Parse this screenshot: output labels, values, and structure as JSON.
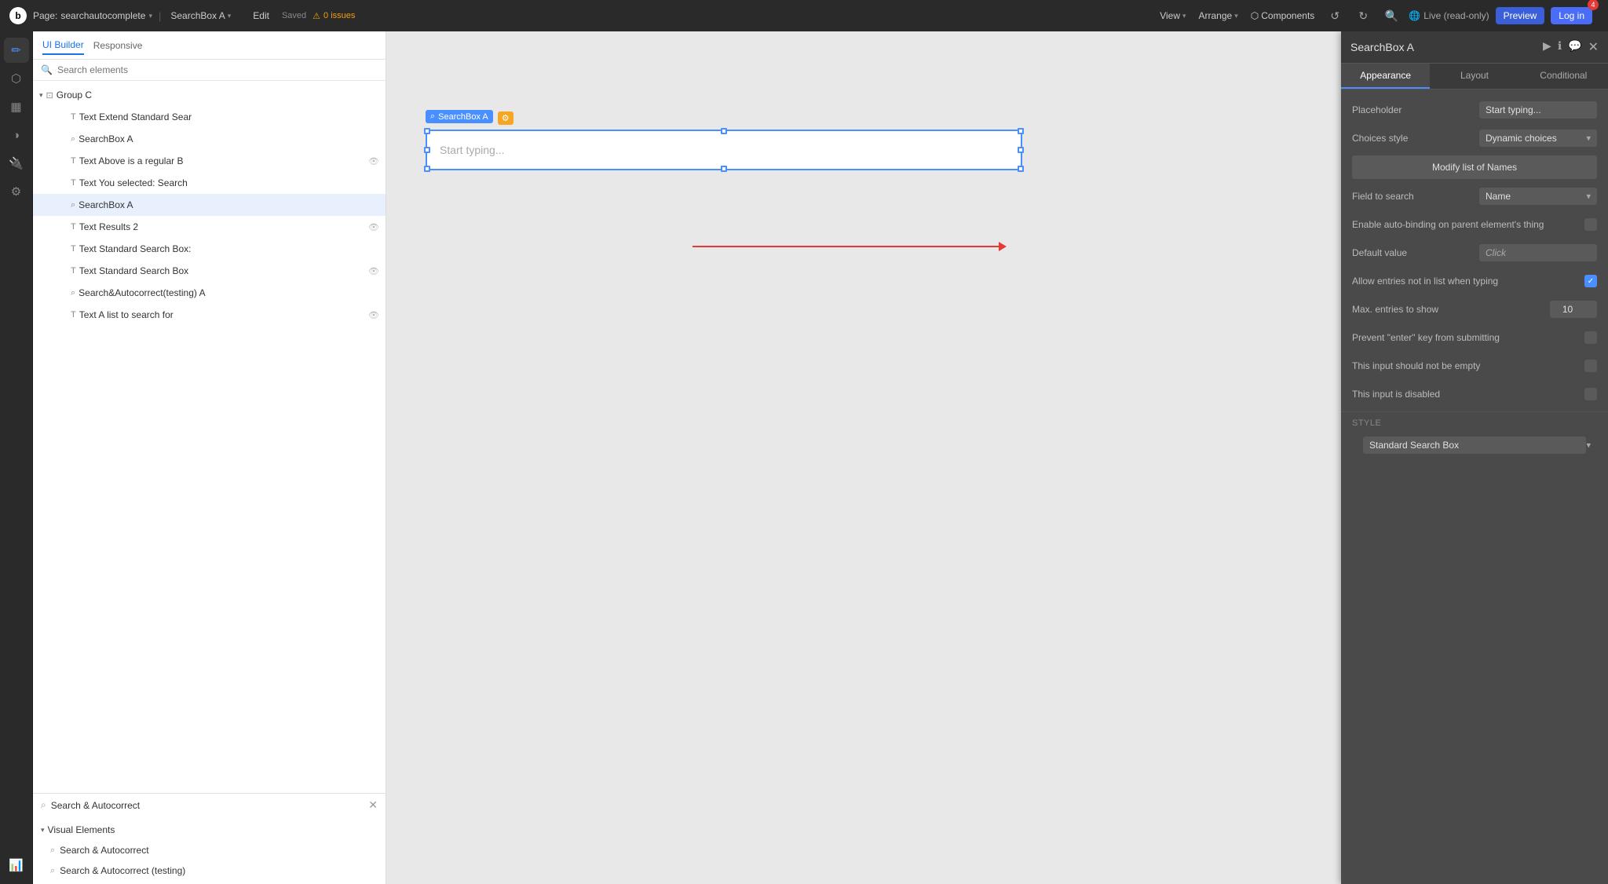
{
  "topbar": {
    "logo": "b",
    "page_label": "Page:",
    "page_name": "searchautocomplete",
    "component_name": "SearchBox A",
    "edit_label": "Edit",
    "saved_label": "Saved",
    "issues_count": "0 issues",
    "view_label": "View",
    "arrange_label": "Arrange",
    "components_label": "Components",
    "live_label": "Live (read-only)",
    "preview_label": "Preview",
    "login_label": "Log in",
    "notification_count": "4"
  },
  "left_panel": {
    "tab_ui_builder": "UI Builder",
    "tab_responsive": "Responsive",
    "search_placeholder": "Search elements",
    "tree_items": [
      {
        "indent": 0,
        "icon": "⊡",
        "label": "Group C",
        "has_arrow": true,
        "eye": false
      },
      {
        "indent": 1,
        "icon": "T",
        "label": "Text Extend Standard Sear",
        "eye": false
      },
      {
        "indent": 1,
        "icon": "⌕",
        "label": "SearchBox A",
        "eye": false
      },
      {
        "indent": 1,
        "icon": "T",
        "label": "Text Above is a regular B",
        "eye": true
      },
      {
        "indent": 1,
        "icon": "T",
        "label": "Text You selected: Search",
        "eye": false
      },
      {
        "indent": 1,
        "icon": "⌕",
        "label": "SearchBox A",
        "eye": false,
        "selected": true
      },
      {
        "indent": 1,
        "icon": "T",
        "label": "Text Results 2",
        "eye": true
      },
      {
        "indent": 1,
        "icon": "T",
        "label": "Text Standard Search Box:",
        "eye": false
      },
      {
        "indent": 1,
        "icon": "T",
        "label": "Text Standard Search Box",
        "eye": true
      },
      {
        "indent": 1,
        "icon": "⌕",
        "label": "Search&Autocorrect(testing) A",
        "eye": false
      },
      {
        "indent": 1,
        "icon": "T",
        "label": "Text A list to search for",
        "eye": true
      }
    ]
  },
  "bottom_search_panel": {
    "title": "Search & Autocorrect",
    "section": "Visual Elements",
    "items": [
      {
        "icon": "⌕",
        "label": "Search & Autocorrect"
      },
      {
        "icon": "⌕",
        "label": "Search & Autocorrect (testing)"
      }
    ]
  },
  "canvas": {
    "element_label": "SearchBox A",
    "element_placeholder": "Start typing..."
  },
  "props_panel": {
    "title": "SearchBox A",
    "tabs": [
      "Appearance",
      "Layout",
      "Conditional"
    ],
    "active_tab": "Appearance",
    "placeholder_label": "Placeholder",
    "placeholder_value": "Start typing...",
    "choices_style_label": "Choices style",
    "choices_style_value": "Dynamic choices",
    "modify_list_label": "Modify list of Names",
    "field_to_search_label": "Field to search",
    "field_to_search_value": "Name",
    "auto_binding_label": "Enable auto-binding on parent element's thing",
    "default_value_label": "Default value",
    "default_value_placeholder": "Click",
    "allow_entries_label": "Allow entries not in list when typing",
    "allow_entries_checked": true,
    "max_entries_label": "Max. entries to show",
    "max_entries_value": "10",
    "prevent_enter_label": "Prevent \"enter\" key from submitting",
    "prevent_enter_checked": false,
    "not_empty_label": "This input should not be empty",
    "not_empty_checked": false,
    "disabled_label": "This input is disabled",
    "disabled_checked": false,
    "style_section_label": "Style",
    "style_value": "Standard Search Box"
  }
}
